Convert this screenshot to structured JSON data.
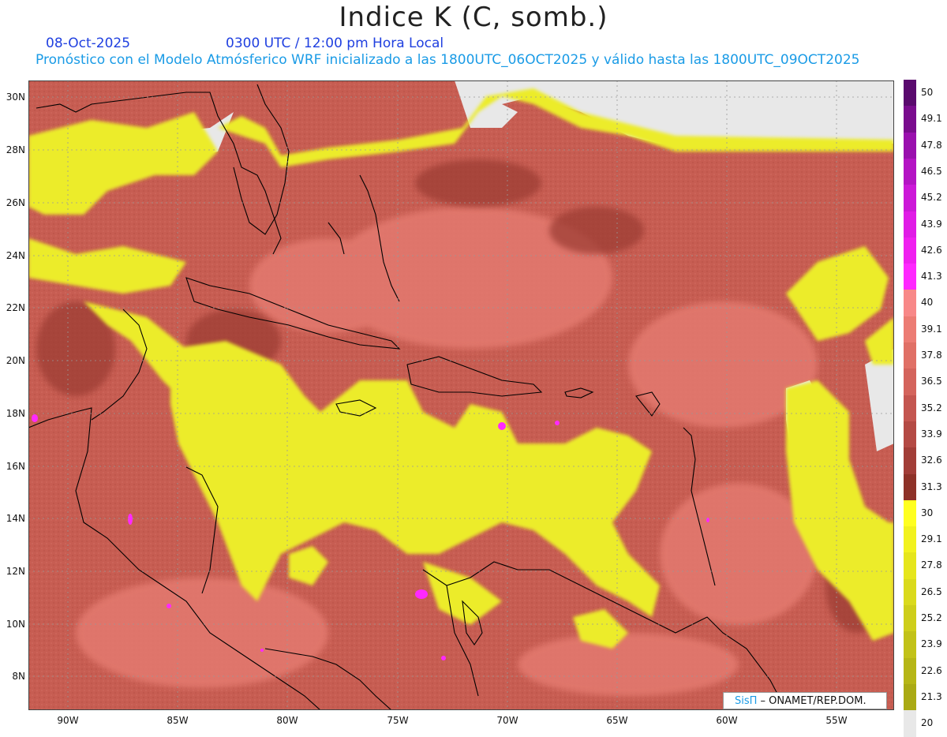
{
  "title": "Indice K (C, somb.)",
  "date": "08-Oct-2025",
  "valid_time": "0300 UTC / 12:00 pm Hora Local",
  "model_info": "Pronóstico con el Modelo Atmósferico WRF inicializado a las 1800UTC_06OCT2025 y válido hasta las  1800UTC_09OCT2025",
  "credit": {
    "brand": "SisΠ",
    "text": " – ONAMET/REP.DOM."
  },
  "lat_labels": [
    "30N",
    "28N",
    "26N",
    "24N",
    "22N",
    "20N",
    "18N",
    "16N",
    "14N",
    "12N",
    "10N",
    "8N"
  ],
  "lon_labels": [
    "90W",
    "85W",
    "80W",
    "75W",
    "70W",
    "65W",
    "60W",
    "55W"
  ],
  "colorbar": {
    "labels": [
      "50",
      "49.1",
      "47.8",
      "46.5",
      "45.2",
      "43.9",
      "42.6",
      "41.3",
      "40",
      "39.1",
      "37.8",
      "36.5",
      "35.2",
      "33.9",
      "32.6",
      "31.3",
      "30",
      "29.1",
      "27.8",
      "26.5",
      "25.2",
      "23.9",
      "22.6",
      "21.3",
      "20"
    ],
    "colors": [
      "#5a0a6e",
      "#7a0c8e",
      "#9a10ae",
      "#b414c4",
      "#cc18d8",
      "#e01ce6",
      "#f020f0",
      "#ff28ff",
      "#f88888",
      "#ec7c74",
      "#e07066",
      "#d4645c",
      "#c45650",
      "#b44a44",
      "#a23e38",
      "#8e3228",
      "#ffff20",
      "#f2f21e",
      "#e6e61c",
      "#dada1c",
      "#cece1a",
      "#c2c218",
      "#b6b616",
      "#aaaa14",
      "#e8e8e8"
    ]
  },
  "colors": {
    "warm_field": "#c55a50",
    "cool_field": "#ecec2a",
    "ocean_base": "#cc5c50",
    "land_outline": "#000000",
    "no_data": "#e6e6e6"
  }
}
